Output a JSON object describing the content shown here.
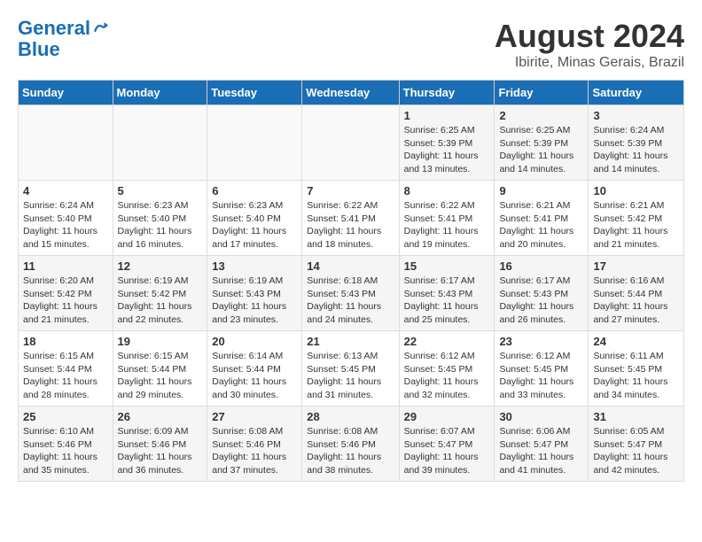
{
  "header": {
    "logo_line1": "General",
    "logo_line2": "Blue",
    "month_year": "August 2024",
    "location": "Ibirite, Minas Gerais, Brazil"
  },
  "days_of_week": [
    "Sunday",
    "Monday",
    "Tuesday",
    "Wednesday",
    "Thursday",
    "Friday",
    "Saturday"
  ],
  "weeks": [
    [
      {
        "day": "",
        "info": ""
      },
      {
        "day": "",
        "info": ""
      },
      {
        "day": "",
        "info": ""
      },
      {
        "day": "",
        "info": ""
      },
      {
        "day": "1",
        "info": "Sunrise: 6:25 AM\nSunset: 5:39 PM\nDaylight: 11 hours\nand 13 minutes."
      },
      {
        "day": "2",
        "info": "Sunrise: 6:25 AM\nSunset: 5:39 PM\nDaylight: 11 hours\nand 14 minutes."
      },
      {
        "day": "3",
        "info": "Sunrise: 6:24 AM\nSunset: 5:39 PM\nDaylight: 11 hours\nand 14 minutes."
      }
    ],
    [
      {
        "day": "4",
        "info": "Sunrise: 6:24 AM\nSunset: 5:40 PM\nDaylight: 11 hours\nand 15 minutes."
      },
      {
        "day": "5",
        "info": "Sunrise: 6:23 AM\nSunset: 5:40 PM\nDaylight: 11 hours\nand 16 minutes."
      },
      {
        "day": "6",
        "info": "Sunrise: 6:23 AM\nSunset: 5:40 PM\nDaylight: 11 hours\nand 17 minutes."
      },
      {
        "day": "7",
        "info": "Sunrise: 6:22 AM\nSunset: 5:41 PM\nDaylight: 11 hours\nand 18 minutes."
      },
      {
        "day": "8",
        "info": "Sunrise: 6:22 AM\nSunset: 5:41 PM\nDaylight: 11 hours\nand 19 minutes."
      },
      {
        "day": "9",
        "info": "Sunrise: 6:21 AM\nSunset: 5:41 PM\nDaylight: 11 hours\nand 20 minutes."
      },
      {
        "day": "10",
        "info": "Sunrise: 6:21 AM\nSunset: 5:42 PM\nDaylight: 11 hours\nand 21 minutes."
      }
    ],
    [
      {
        "day": "11",
        "info": "Sunrise: 6:20 AM\nSunset: 5:42 PM\nDaylight: 11 hours\nand 21 minutes."
      },
      {
        "day": "12",
        "info": "Sunrise: 6:19 AM\nSunset: 5:42 PM\nDaylight: 11 hours\nand 22 minutes."
      },
      {
        "day": "13",
        "info": "Sunrise: 6:19 AM\nSunset: 5:43 PM\nDaylight: 11 hours\nand 23 minutes."
      },
      {
        "day": "14",
        "info": "Sunrise: 6:18 AM\nSunset: 5:43 PM\nDaylight: 11 hours\nand 24 minutes."
      },
      {
        "day": "15",
        "info": "Sunrise: 6:17 AM\nSunset: 5:43 PM\nDaylight: 11 hours\nand 25 minutes."
      },
      {
        "day": "16",
        "info": "Sunrise: 6:17 AM\nSunset: 5:43 PM\nDaylight: 11 hours\nand 26 minutes."
      },
      {
        "day": "17",
        "info": "Sunrise: 6:16 AM\nSunset: 5:44 PM\nDaylight: 11 hours\nand 27 minutes."
      }
    ],
    [
      {
        "day": "18",
        "info": "Sunrise: 6:15 AM\nSunset: 5:44 PM\nDaylight: 11 hours\nand 28 minutes."
      },
      {
        "day": "19",
        "info": "Sunrise: 6:15 AM\nSunset: 5:44 PM\nDaylight: 11 hours\nand 29 minutes."
      },
      {
        "day": "20",
        "info": "Sunrise: 6:14 AM\nSunset: 5:44 PM\nDaylight: 11 hours\nand 30 minutes."
      },
      {
        "day": "21",
        "info": "Sunrise: 6:13 AM\nSunset: 5:45 PM\nDaylight: 11 hours\nand 31 minutes."
      },
      {
        "day": "22",
        "info": "Sunrise: 6:12 AM\nSunset: 5:45 PM\nDaylight: 11 hours\nand 32 minutes."
      },
      {
        "day": "23",
        "info": "Sunrise: 6:12 AM\nSunset: 5:45 PM\nDaylight: 11 hours\nand 33 minutes."
      },
      {
        "day": "24",
        "info": "Sunrise: 6:11 AM\nSunset: 5:45 PM\nDaylight: 11 hours\nand 34 minutes."
      }
    ],
    [
      {
        "day": "25",
        "info": "Sunrise: 6:10 AM\nSunset: 5:46 PM\nDaylight: 11 hours\nand 35 minutes."
      },
      {
        "day": "26",
        "info": "Sunrise: 6:09 AM\nSunset: 5:46 PM\nDaylight: 11 hours\nand 36 minutes."
      },
      {
        "day": "27",
        "info": "Sunrise: 6:08 AM\nSunset: 5:46 PM\nDaylight: 11 hours\nand 37 minutes."
      },
      {
        "day": "28",
        "info": "Sunrise: 6:08 AM\nSunset: 5:46 PM\nDaylight: 11 hours\nand 38 minutes."
      },
      {
        "day": "29",
        "info": "Sunrise: 6:07 AM\nSunset: 5:47 PM\nDaylight: 11 hours\nand 39 minutes."
      },
      {
        "day": "30",
        "info": "Sunrise: 6:06 AM\nSunset: 5:47 PM\nDaylight: 11 hours\nand 41 minutes."
      },
      {
        "day": "31",
        "info": "Sunrise: 6:05 AM\nSunset: 5:47 PM\nDaylight: 11 hours\nand 42 minutes."
      }
    ]
  ]
}
